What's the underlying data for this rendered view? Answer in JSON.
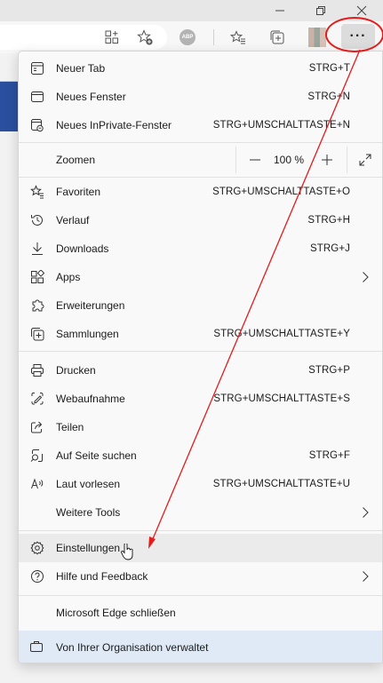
{
  "window": {
    "minimize_glyph": "—",
    "restore_glyph": "❐",
    "close_glyph": "✕"
  },
  "toolbar": {
    "icons": [
      "grid-plus-icon",
      "favorite-add-icon",
      "abp-extension-icon",
      "favorites-icon",
      "collections-icon",
      "profile-avatar",
      "more-options-icon"
    ],
    "abp_label": "ABP",
    "more_label": "···"
  },
  "menu": {
    "items": [
      {
        "id": "new-tab",
        "icon": "new-tab-icon",
        "label": "Neuer Tab",
        "shortcut": "STRG+T"
      },
      {
        "id": "new-window",
        "icon": "new-window-icon",
        "label": "Neues Fenster",
        "shortcut": "STRG+N"
      },
      {
        "id": "inprivate",
        "icon": "inprivate-window-icon",
        "label": "Neues InPrivate-Fenster",
        "shortcut": "STRG+UMSCHALTTASTE+N"
      },
      {
        "id": "favorites",
        "icon": "favorites-star-icon",
        "label": "Favoriten",
        "shortcut": "STRG+UMSCHALTTASTE+O"
      },
      {
        "id": "history",
        "icon": "history-icon",
        "label": "Verlauf",
        "shortcut": "STRG+H"
      },
      {
        "id": "downloads",
        "icon": "download-icon",
        "label": "Downloads",
        "shortcut": "STRG+J"
      },
      {
        "id": "apps",
        "icon": "apps-icon",
        "label": "Apps",
        "shortcut": ""
      },
      {
        "id": "extensions",
        "icon": "extensions-puzzle-icon",
        "label": "Erweiterungen",
        "shortcut": ""
      },
      {
        "id": "collections",
        "icon": "collections-icon",
        "label": "Sammlungen",
        "shortcut": "STRG+UMSCHALTTASTE+Y"
      },
      {
        "id": "print",
        "icon": "printer-icon",
        "label": "Drucken",
        "shortcut": "STRG+P"
      },
      {
        "id": "webcapture",
        "icon": "web-capture-icon",
        "label": "Webaufnahme",
        "shortcut": "STRG+UMSCHALTTASTE+S"
      },
      {
        "id": "share",
        "icon": "share-icon",
        "label": "Teilen",
        "shortcut": ""
      },
      {
        "id": "find",
        "icon": "find-on-page-icon",
        "label": "Auf Seite suchen",
        "shortcut": "STRG+F"
      },
      {
        "id": "read-aloud",
        "icon": "read-aloud-icon",
        "label": "Laut vorlesen",
        "shortcut": "STRG+UMSCHALTTASTE+U"
      },
      {
        "id": "more-tools",
        "icon": "",
        "label": "Weitere Tools",
        "shortcut": ""
      },
      {
        "id": "settings",
        "icon": "settings-gear-icon",
        "label": "Einstellungen",
        "shortcut": ""
      },
      {
        "id": "help",
        "icon": "help-icon",
        "label": "Hilfe und Feedback",
        "shortcut": ""
      },
      {
        "id": "close-edge",
        "icon": "",
        "label": "Microsoft Edge schließen",
        "shortcut": ""
      }
    ],
    "zoom": {
      "label": "Zoomen",
      "minus": "—",
      "value": "100 %",
      "plus": "+",
      "fullscreen_icon": "fullscreen-icon"
    },
    "managed": {
      "icon": "briefcase-icon",
      "label": "Von Ihrer Organisation verwaltet"
    }
  },
  "annotation": {
    "color": "#e21b1b"
  },
  "colors": {
    "menu_bg": "#f9f9f9",
    "hover_bg": "#ebebeb",
    "managed_bg": "#dfeaf6",
    "page_accent": "#2a4f9e"
  }
}
